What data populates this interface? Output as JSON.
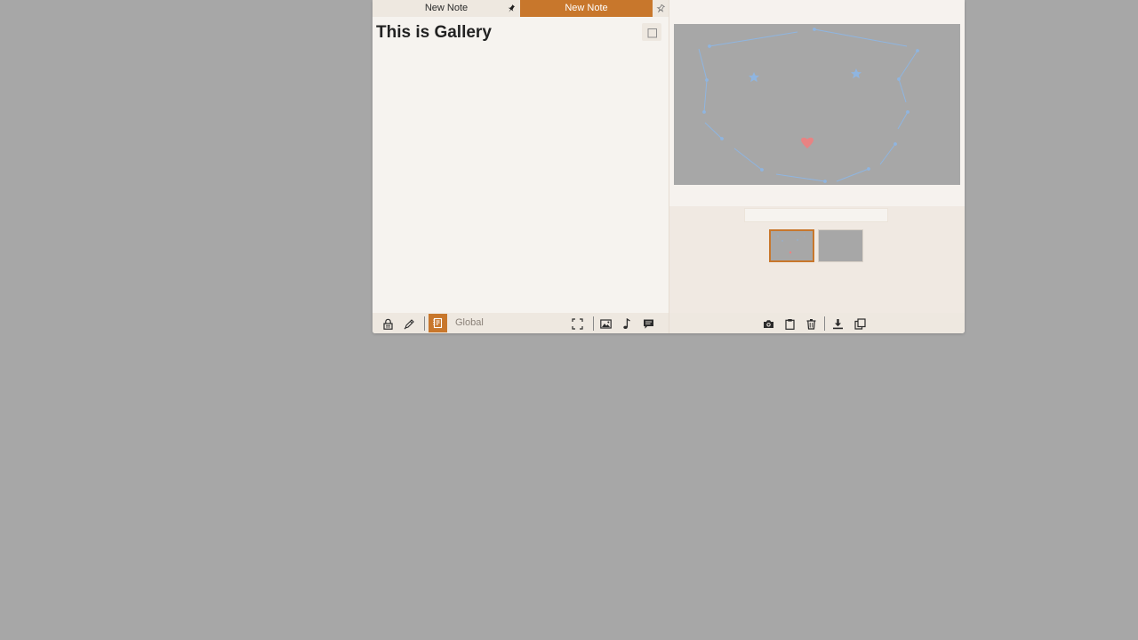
{
  "tabs": [
    {
      "label": "New Note",
      "active": false,
      "pin_icon": "pin-icon"
    },
    {
      "label": "New Note",
      "active": true,
      "pin_icon": "pin-icon"
    }
  ],
  "note": {
    "title": "This is Gallery"
  },
  "toolbar_left": {
    "icons": [
      "lock-icon",
      "pen-icon",
      "notebook-icon",
      "fullscreen-icon",
      "image-icon",
      "music-note-icon",
      "comment-icon"
    ],
    "scope_label": "Global"
  },
  "gallery": {
    "caption_placeholder": "",
    "caption_value": "",
    "thumbnail_count": 2,
    "selected_thumbnail": 1
  },
  "toolbar_right": {
    "icons": [
      "camera-icon",
      "clipboard-icon",
      "trash-icon",
      "download-icon",
      "copy-icon"
    ]
  },
  "colors": {
    "accent": "#c8772c",
    "background": "#a7a7a7",
    "panel": "#f6f3ef",
    "toolbar": "#eee8e0",
    "sketch_stroke": "#8fb5e0",
    "sketch_heart": "#f08080"
  }
}
